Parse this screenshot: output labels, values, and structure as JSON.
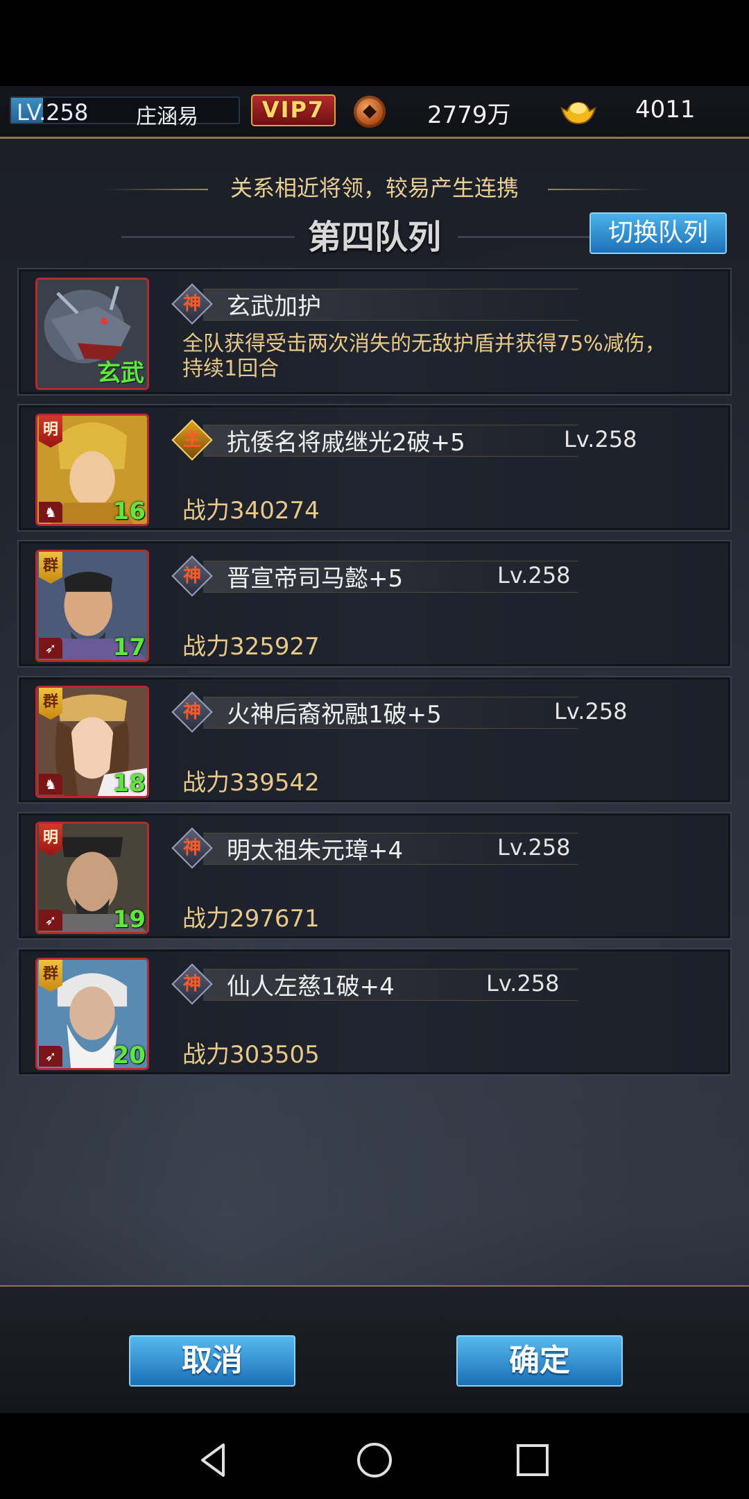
{
  "topbar": {
    "level": "LV.258",
    "level_progress": 0.14,
    "player_name": "庄涵易",
    "vip": "VIP7",
    "coins": "2779万",
    "gold": "4011",
    "coin_icon": "copper-coin-icon",
    "gold_icon": "gold-ingot-icon"
  },
  "hint": "关系相近将领，较易产生连携",
  "team_title": "第四队列",
  "switch_label": "切换队列",
  "beast": {
    "skill_name": "玄武加护",
    "badge": "神",
    "description": "全队获得受击两次消失的无敌护盾并获得75%减伤，持续1回合",
    "label": "玄武"
  },
  "generals": [
    {
      "badge": "主",
      "name": "抗倭名将戚继光2破+5",
      "level": "Lv.258",
      "power": "战力340274",
      "slot": "16",
      "faction": "明"
    },
    {
      "badge": "神",
      "name": "晋宣帝司马懿+5",
      "level": "Lv.258",
      "power": "战力325927",
      "slot": "17",
      "faction": "群"
    },
    {
      "badge": "神",
      "name": "火神后裔祝融1破+5",
      "level": "Lv.258",
      "power": "战力339542",
      "slot": "18",
      "faction": "群"
    },
    {
      "badge": "神",
      "name": "明太祖朱元璋+4",
      "level": "Lv.258",
      "power": "战力297671",
      "slot": "19",
      "faction": "明"
    },
    {
      "badge": "神",
      "name": "仙人左慈1破+4",
      "level": "Lv.258",
      "power": "战力303505",
      "slot": "20",
      "faction": "群"
    }
  ],
  "buttons": {
    "cancel": "取消",
    "confirm": "确定"
  },
  "nav": [
    "back-icon",
    "home-icon",
    "recents-icon"
  ]
}
